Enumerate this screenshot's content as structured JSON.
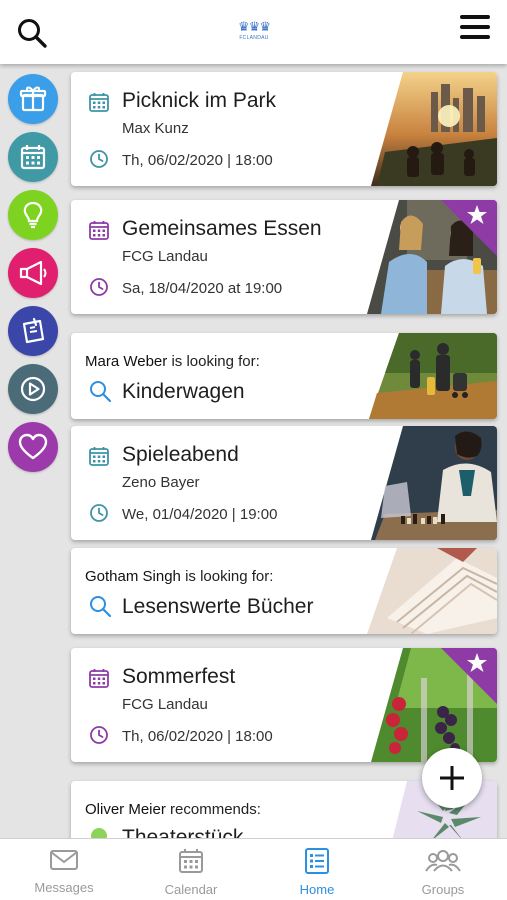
{
  "header": {
    "logo_text": "FCLANDAU",
    "search_icon": "search-icon",
    "menu_icon": "hamburger-menu-icon"
  },
  "sidebar": {
    "items": [
      {
        "name": "gift",
        "color": "#3a9ee8"
      },
      {
        "name": "calendar",
        "color": "#3f9aa6"
      },
      {
        "name": "idea",
        "color": "#7ed321"
      },
      {
        "name": "megaphone",
        "color": "#e0206e"
      },
      {
        "name": "note",
        "color": "#3b47a8"
      },
      {
        "name": "play",
        "color": "#4b6b79"
      },
      {
        "name": "heart",
        "color": "#9c3aab"
      }
    ]
  },
  "feed": {
    "events": [
      {
        "title": "Picknick im Park",
        "organizer": "Max Kunz",
        "datetime": "Th, 06/02/2020 | 18:00",
        "accent": "#3d94a6",
        "featured": false
      },
      {
        "title": "Gemeinsames Essen",
        "organizer": "FCG Landau",
        "datetime": "Sa, 18/04/2020 at 19:00",
        "accent": "#8e3ba6",
        "featured": true
      },
      {
        "title": "Spieleabend",
        "organizer": "Zeno Bayer",
        "datetime": "We, 01/04/2020 | 19:00",
        "accent": "#3d94a6",
        "featured": false
      },
      {
        "title": "Sommerfest",
        "organizer": "FCG Landau",
        "datetime": "Th, 06/02/2020 | 18:00",
        "accent": "#8e3ba6",
        "featured": true
      }
    ],
    "searches": [
      {
        "person": "Mara Weber",
        "phrase": "is looking for:",
        "item": "Kinderwagen"
      },
      {
        "person": "Gotham Singh",
        "phrase": "is looking for:",
        "item": "Lesenswerte Bücher"
      }
    ],
    "recommendation": {
      "person": "Oliver Meier",
      "phrase": "recommends:",
      "item": "Theaterstück"
    }
  },
  "bottom_nav": {
    "tabs": [
      {
        "label": "Messages",
        "icon": "envelope-icon",
        "active": false
      },
      {
        "label": "Calendar",
        "icon": "calendar-icon",
        "active": false
      },
      {
        "label": "Home",
        "icon": "list-icon",
        "active": true
      },
      {
        "label": "Groups",
        "icon": "group-icon",
        "active": false
      }
    ]
  },
  "colors": {
    "active_tab": "#2d8fe0",
    "inactive_tab": "#9a9a9a",
    "star_ribbon": "#8e3ba6",
    "search_accent": "#2d8fe0"
  }
}
